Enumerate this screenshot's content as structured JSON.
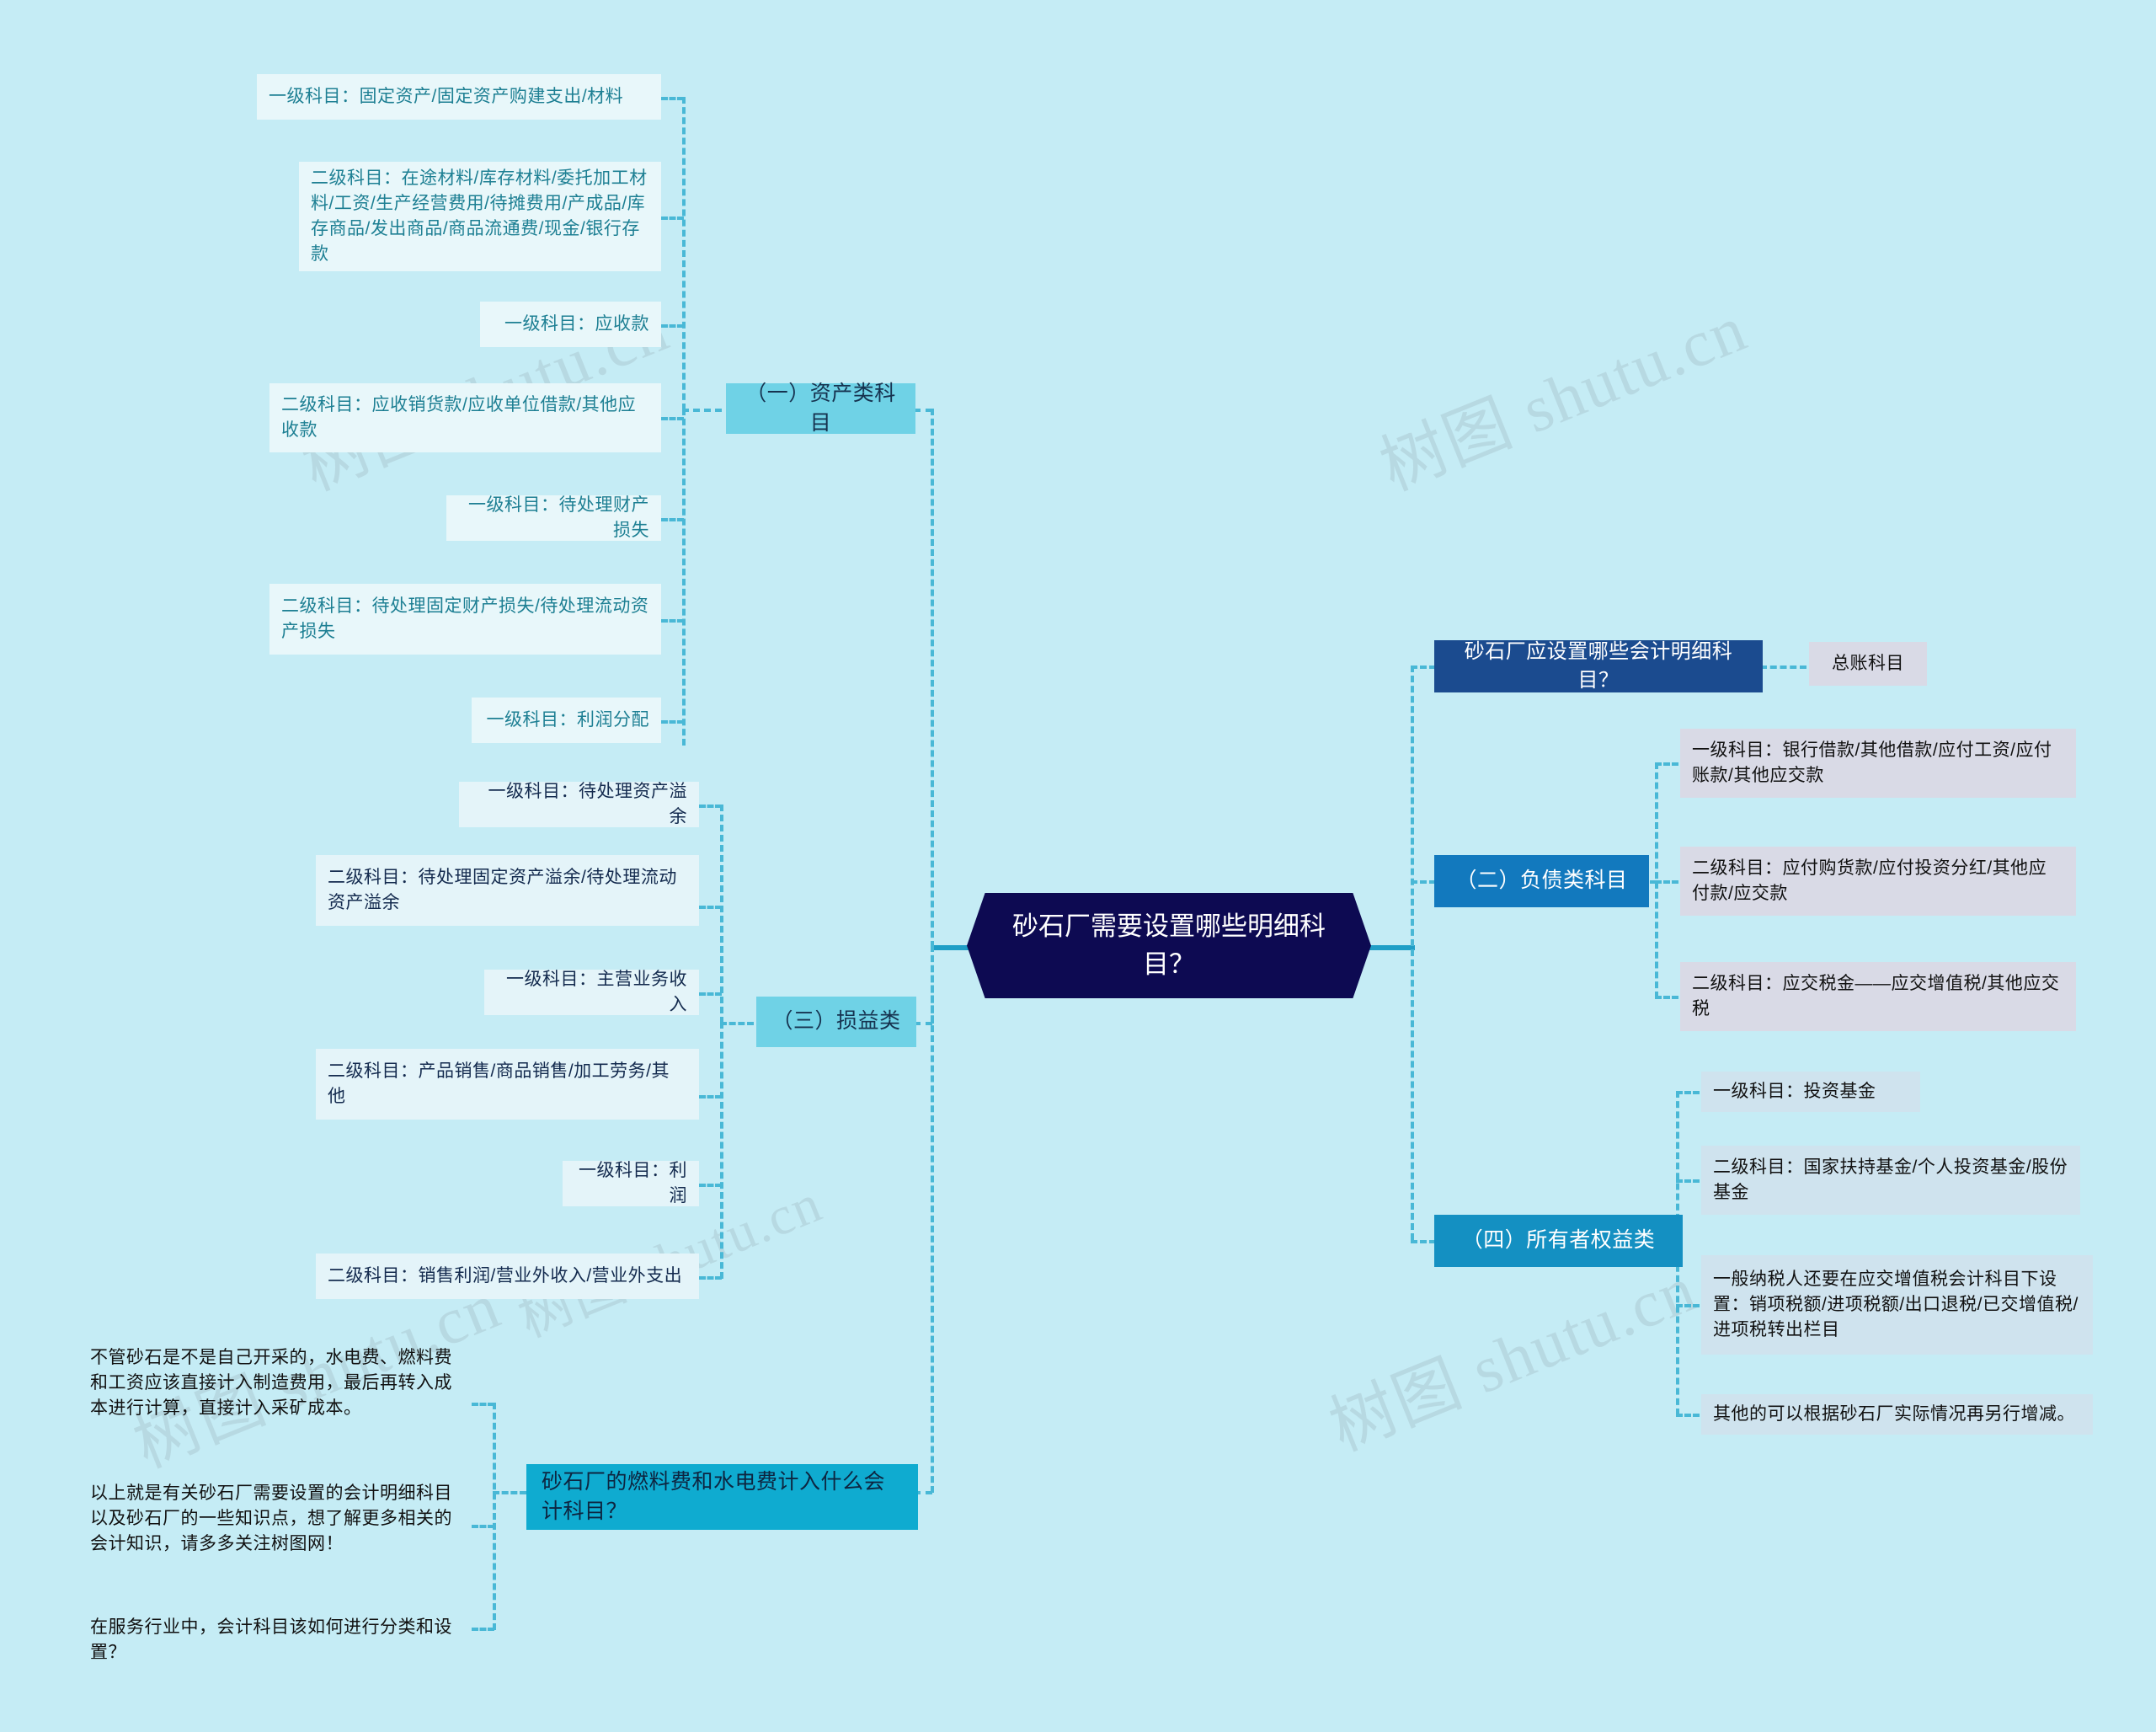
{
  "theme": {
    "background": "#c5ecf5",
    "hub_bg": "#0d0a52",
    "accent_cyan": "#6fd2e6",
    "accent_blue": "#1279be",
    "accent_blue2": "#1490c2",
    "accent_navy": "#1b4b8f",
    "accent_teal": "#0fabd0",
    "leaf_teal_bg": "#e8f7fa",
    "leaf_grey_bg": "#d9dae6",
    "connector": "#49b8d6"
  },
  "watermark": {
    "text": "树图 shutu.cn"
  },
  "hub": {
    "title": "砂石厂需要设置哪些明细科目？"
  },
  "left_branch": {
    "assets": {
      "label": "（一）资产类科目",
      "items": [
        {
          "text": "一级科目：固定资产/固定资产购建支出/材料"
        },
        {
          "text": "二级科目：在途材料/库存材料/委托加工材料/工资/生产经营费用/待摊费用/产成品/库存商品/发出商品/商品流通费/现金/银行存款"
        },
        {
          "text": "一级科目：应收款"
        },
        {
          "text": "二级科目：应收销货款/应收单位借款/其他应收款"
        },
        {
          "text": "一级科目：待处理财产损失"
        },
        {
          "text": "二级科目：待处理固定财产损失/待处理流动资产损失"
        },
        {
          "text": "一级科目：利润分配"
        }
      ]
    },
    "profit_loss": {
      "label": "（三）损益类",
      "items": [
        {
          "text": "一级科目：待处理资产溢余"
        },
        {
          "text": "二级科目：待处理固定资产溢余/待处理流动资产溢余"
        },
        {
          "text": "一级科目：主营业务收入"
        },
        {
          "text": "二级科目：产品销售/商品销售/加工劳务/其他"
        },
        {
          "text": "一级科目：利润"
        },
        {
          "text": "二级科目：销售利润/营业外收入/营业外支出"
        }
      ]
    },
    "fuel_question": {
      "label": "砂石厂的燃料费和水电费计入什么会计科目？",
      "items": [
        {
          "text": "不管砂石是不是自己开采的，水电费、燃料费和工资应该直接计入制造费用，最后再转入成本进行计算，直接计入采矿成本。"
        },
        {
          "text": "以上就是有关砂石厂需要设置的会计明细科目以及砂石厂的一些知识点，想了解更多相关的会计知识，请多多关注树图网！"
        },
        {
          "text": "在服务行业中，会计科目该如何进行分类和设置？"
        }
      ]
    }
  },
  "right_branch": {
    "detail_question": {
      "label": "砂石厂应设置哪些会计明细科目？",
      "items": [
        {
          "text": "总账科目"
        }
      ]
    },
    "liabilities": {
      "label": "（二）负债类科目",
      "items": [
        {
          "text": "一级科目：银行借款/其他借款/应付工资/应付账款/其他应交款"
        },
        {
          "text": "二级科目：应付购货款/应付投资分红/其他应付款/应交款"
        },
        {
          "text": "二级科目：应交税金——应交增值税/其他应交税"
        }
      ]
    },
    "owners_equity": {
      "label": "（四）所有者权益类",
      "items": [
        {
          "text": "一级科目：投资基金"
        },
        {
          "text": "二级科目：国家扶持基金/个人投资基金/股份基金"
        },
        {
          "text": "一般纳税人还要在应交增值税会计科目下设置：销项税额/进项税额/出口退税/已交增值税/进项税转出栏目"
        },
        {
          "text": "其他的可以根据砂石厂实际情况再另行增减。"
        }
      ]
    }
  }
}
